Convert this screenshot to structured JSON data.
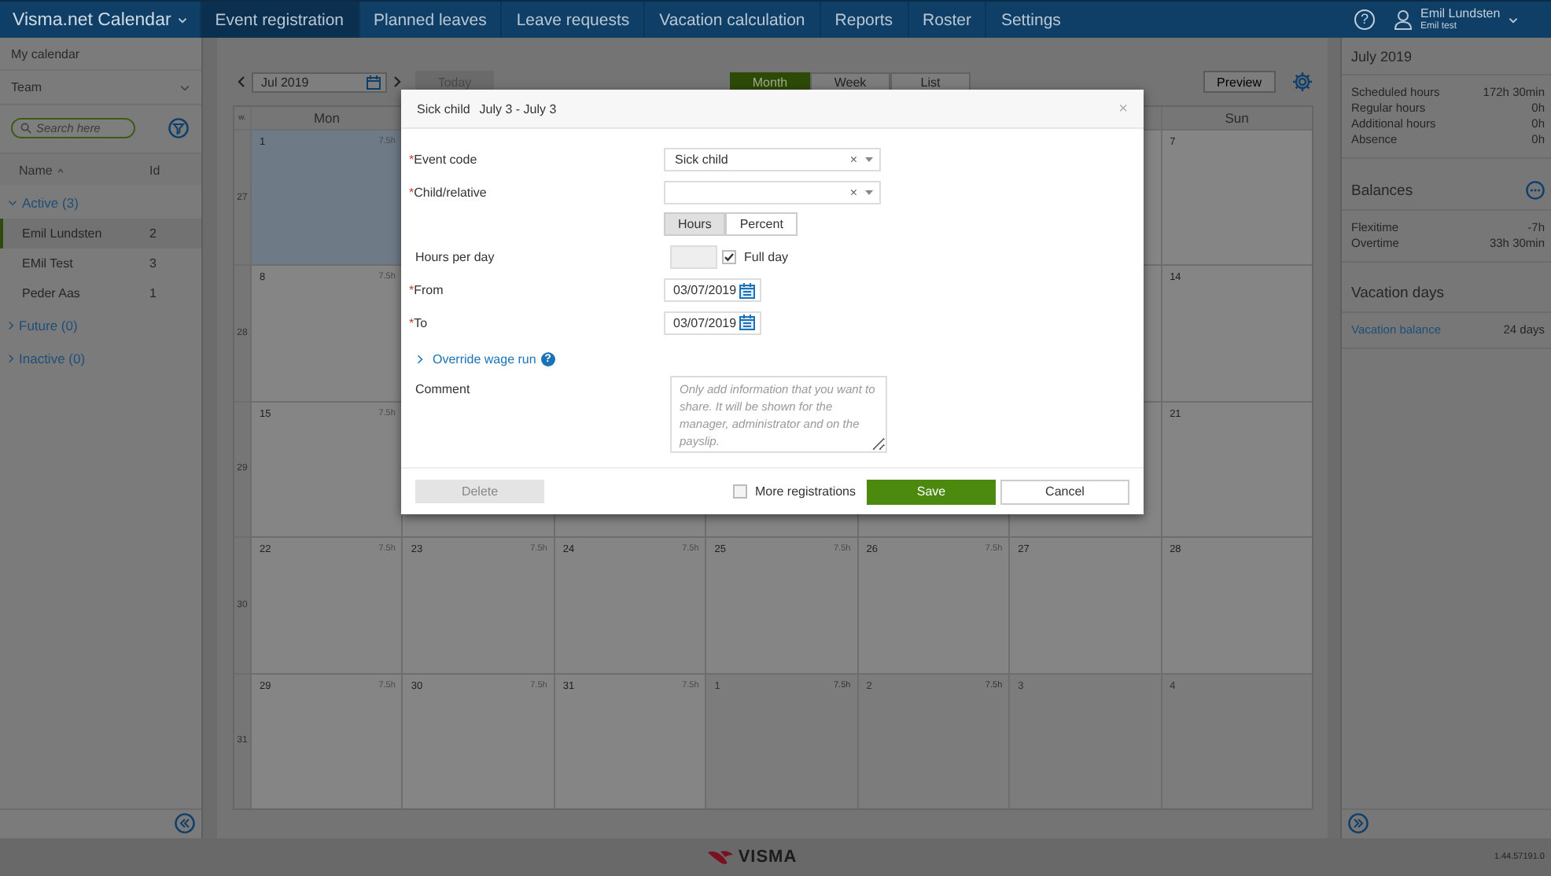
{
  "app_menu": {
    "label": "Visma.net Calendar"
  },
  "nav": [
    {
      "label": "Event registration",
      "selected": true
    },
    {
      "label": "Planned leaves",
      "selected": false
    },
    {
      "label": "Leave requests",
      "selected": false
    },
    {
      "label": "Vacation calculation",
      "selected": false
    },
    {
      "label": "Reports",
      "selected": false
    },
    {
      "label": "Roster",
      "selected": false
    },
    {
      "label": "Settings",
      "selected": false
    }
  ],
  "help": "?",
  "user": {
    "name": "Emil Lundsten",
    "subtitle": "Emil test"
  },
  "sidebar": {
    "my_calendar": "My calendar",
    "team": "Team",
    "search": {
      "placeholder": "Search here"
    },
    "name_header": "Name",
    "id_header": "Id",
    "groups": [
      {
        "label": "Active (3)",
        "expanded": true,
        "members": [
          {
            "name": "Emil Lundsten",
            "id": "2",
            "selected": true
          },
          {
            "name": "EMil Test",
            "id": "3",
            "selected": false
          },
          {
            "name": "Peder Aas",
            "id": "1",
            "selected": false
          }
        ]
      },
      {
        "label": "Future (0)",
        "expanded": false
      },
      {
        "label": "Inactive (0)",
        "expanded": false
      }
    ]
  },
  "toolbar": {
    "month": "Jul 2019",
    "today": {
      "label": "Today",
      "disabled": true
    },
    "views": [
      {
        "label": "Month",
        "selected": true
      },
      {
        "label": "Week",
        "selected": false
      },
      {
        "label": "List",
        "selected": false
      }
    ],
    "preview": "Preview"
  },
  "calendar": {
    "week_label": "w.",
    "headers": [
      "Mon",
      "Sun"
    ],
    "weeks": [
      {
        "number": "27",
        "days": [
          {
            "day": "1",
            "hours": "7.5h",
            "selected": true,
            "other_month": false
          },
          {
            "day": "7",
            "selected": false,
            "other_month": false
          }
        ]
      },
      {
        "number": "28",
        "days": [
          {
            "day": "8",
            "hours": "7.5h",
            "selected": false,
            "other_month": false
          },
          {
            "day": "14",
            "selected": false,
            "other_month": false
          }
        ]
      },
      {
        "number": "29",
        "days": [
          {
            "day": "15",
            "hours": "7.5h",
            "selected": false,
            "other_month": false
          },
          {
            "day": "21",
            "selected": false,
            "other_month": false
          }
        ]
      },
      {
        "number": "30",
        "days": [
          {
            "day": "22",
            "hours": "7.5h",
            "selected": false,
            "other_month": false
          },
          {
            "day": "23",
            "hours": "7.5h",
            "selected": false,
            "other_month": false
          },
          {
            "day": "24",
            "hours": "7.5h",
            "selected": false,
            "other_month": false
          },
          {
            "day": "25",
            "hours": "7.5h",
            "selected": false,
            "other_month": false
          },
          {
            "day": "26",
            "hours": "7.5h",
            "selected": false,
            "other_month": false
          },
          {
            "day": "27",
            "selected": false,
            "other_month": false
          },
          {
            "day": "28",
            "selected": false,
            "other_month": false
          }
        ]
      },
      {
        "number": "31",
        "days": [
          {
            "day": "29",
            "hours": "7.5h",
            "selected": false,
            "other_month": false
          },
          {
            "day": "30",
            "hours": "7.5h",
            "selected": false,
            "other_month": false
          },
          {
            "day": "31",
            "hours": "7.5h",
            "selected": false,
            "other_month": false
          },
          {
            "day": "1",
            "hours": "7.5h",
            "selected": false,
            "other_month": true
          },
          {
            "day": "2",
            "hours": "7.5h",
            "selected": false,
            "other_month": true
          },
          {
            "day": "3",
            "selected": false,
            "other_month": true
          },
          {
            "day": "4",
            "selected": false,
            "other_month": true
          }
        ]
      }
    ]
  },
  "summary": {
    "title": "July 2019",
    "stats": [
      {
        "label": "Scheduled hours",
        "value": "172h 30min"
      },
      {
        "label": "Regular hours",
        "value": "0h"
      },
      {
        "label": "Additional hours",
        "value": "0h"
      },
      {
        "label": "Absence",
        "value": "0h"
      }
    ],
    "balances_title": "Balances",
    "balances": [
      {
        "label": "Flexitime",
        "value": "-7h"
      },
      {
        "label": "Overtime",
        "value": "33h 30min"
      }
    ],
    "vacation_title": "Vacation days",
    "vacation": [
      {
        "label": "Vacation balance",
        "value": "24 days"
      }
    ]
  },
  "footer": {
    "logo": "VISMA",
    "version": "1.44.57191.0"
  },
  "modal": {
    "title": "Sick child",
    "dates": "July 3 - July 3",
    "close": "×",
    "fields": [
      {
        "kind": "select",
        "required_mark": "*",
        "label": "Event code",
        "value": "Sick child",
        "clear": "×"
      },
      {
        "kind": "select",
        "required_mark": "*",
        "label": "Child/relative",
        "clear": "×"
      },
      {
        "kind": "segmented",
        "options": [
          {
            "label": "Hours",
            "selected": true
          },
          {
            "label": "Percent",
            "selected": false
          }
        ]
      },
      {
        "kind": "hours",
        "label": "Hours per day",
        "checkbox_label": "Full day",
        "checked": true
      },
      {
        "kind": "date",
        "required_mark": "*",
        "label": "From",
        "value": "03/07/2019"
      },
      {
        "kind": "date",
        "required_mark": "*",
        "label": "To",
        "value": "03/07/2019"
      },
      {
        "kind": "expander",
        "label": "Override wage run",
        "expanded": false,
        "help": "?"
      },
      {
        "kind": "textarea",
        "label": "Comment",
        "placeholder": "Only add information that you want to share. It will be shown for the manager, administrator and on the payslip."
      }
    ],
    "delete": {
      "label": "Delete",
      "disabled": true
    },
    "more": {
      "label": "More registrations",
      "checked": false
    },
    "save": "Save",
    "cancel": "Cancel"
  }
}
